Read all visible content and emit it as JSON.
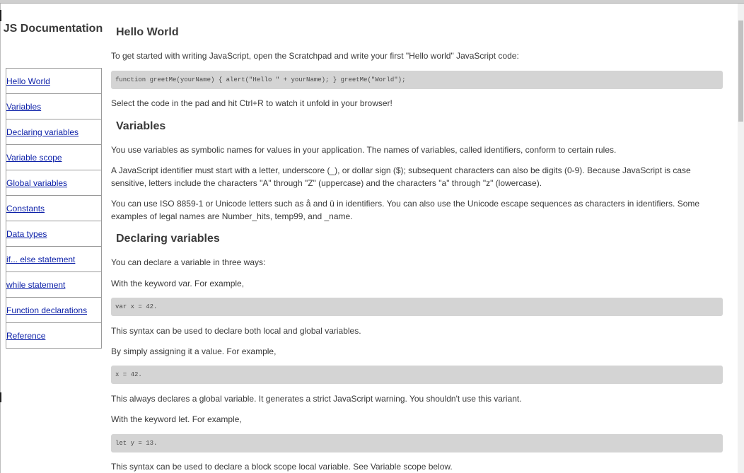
{
  "navbar": {
    "title": "JS Documentation",
    "items": [
      {
        "label": "Hello World"
      },
      {
        "label": "Variables"
      },
      {
        "label": "Declaring variables"
      },
      {
        "label": "Variable scope"
      },
      {
        "label": "Global variables"
      },
      {
        "label": "Constants"
      },
      {
        "label": "Data types"
      },
      {
        "label": "if... else statement"
      },
      {
        "label": "while statement"
      },
      {
        "label": "Function declarations"
      },
      {
        "label": "Reference"
      }
    ]
  },
  "main": {
    "hello": {
      "heading": "Hello World",
      "intro": "To get started with writing JavaScript, open the Scratchpad and write your first \"Hello world\" JavaScript code:",
      "code": "function greetMe(yourName) { alert(\"Hello \" + yourName); } greetMe(\"World\");",
      "outro": "Select the code in the pad and hit Ctrl+R to watch it unfold in your browser!"
    },
    "variables": {
      "heading": "Variables",
      "p1": "You use variables as symbolic names for values in your application. The names of variables, called identifiers, conform to certain rules.",
      "p2": "A JavaScript identifier must start with a letter, underscore (_), or dollar sign ($); subsequent characters can also be digits (0-9). Because JavaScript is case sensitive, letters include the characters \"A\" through \"Z\" (uppercase) and the characters \"a\" through \"z\" (lowercase).",
      "p3": "You can use ISO 8859-1 or Unicode letters such as å and ü in identifiers. You can also use the Unicode escape sequences as characters in identifiers. Some examples of legal names are Number_hits, temp99, and _name."
    },
    "declaring": {
      "heading": "Declaring variables",
      "p1": "You can declare a variable in three ways:",
      "p2": "With the keyword var. For example,",
      "code1": "var x = 42.",
      "p3": "This syntax can be used to declare both local and global variables.",
      "p4": "By simply assigning it a value. For example,",
      "code2": "x = 42.",
      "p5": "This always declares a global variable. It generates a strict JavaScript warning. You shouldn't use this variant.",
      "p6": "With the keyword let. For example,",
      "code3": "let y = 13.",
      "p7": "This syntax can be used to declare a block scope local variable. See Variable scope below."
    }
  }
}
